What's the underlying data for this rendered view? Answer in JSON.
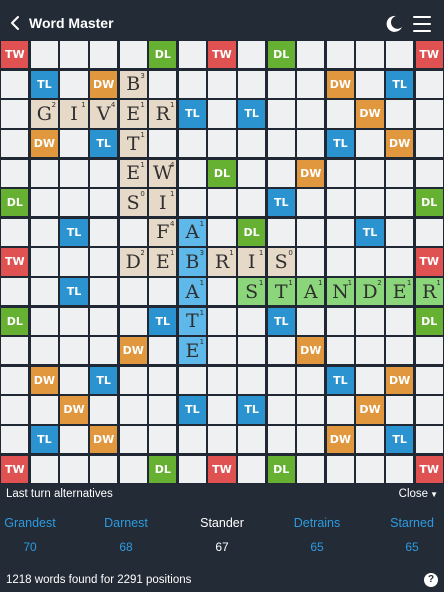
{
  "header": {
    "title": "Word Master",
    "back_icon": "chevron-left-icon",
    "theme_icon": "moon-icon",
    "menu_icon": "hamburger-icon"
  },
  "colors": {
    "TW": "#e05252",
    "DW": "#e0973e",
    "TL": "#2a93d0",
    "DL": "#66b132",
    "tile_placed": "#e6d9c8",
    "tile_blue": "#5fb8ea",
    "tile_green": "#8bd67a",
    "empty": "#eef0f1",
    "background": "#222b36",
    "accent": "#2d9be0"
  },
  "board": {
    "size": 15,
    "premium": [
      {
        "r": 0,
        "c": 0,
        "t": "TW"
      },
      {
        "r": 0,
        "c": 5,
        "t": "DL"
      },
      {
        "r": 0,
        "c": 7,
        "t": "TW"
      },
      {
        "r": 0,
        "c": 9,
        "t": "DL"
      },
      {
        "r": 0,
        "c": 14,
        "t": "TW"
      },
      {
        "r": 1,
        "c": 1,
        "t": "TL"
      },
      {
        "r": 1,
        "c": 3,
        "t": "DW"
      },
      {
        "r": 1,
        "c": 11,
        "t": "DW"
      },
      {
        "r": 1,
        "c": 13,
        "t": "TL"
      },
      {
        "r": 2,
        "c": 6,
        "t": "TL"
      },
      {
        "r": 2,
        "c": 8,
        "t": "TL"
      },
      {
        "r": 2,
        "c": 12,
        "t": "DW"
      },
      {
        "r": 3,
        "c": 1,
        "t": "DW"
      },
      {
        "r": 3,
        "c": 3,
        "t": "TL"
      },
      {
        "r": 3,
        "c": 11,
        "t": "TL"
      },
      {
        "r": 3,
        "c": 13,
        "t": "DW"
      },
      {
        "r": 4,
        "c": 7,
        "t": "DL"
      },
      {
        "r": 4,
        "c": 10,
        "t": "DW"
      },
      {
        "r": 5,
        "c": 0,
        "t": "DL"
      },
      {
        "r": 5,
        "c": 9,
        "t": "TL"
      },
      {
        "r": 5,
        "c": 14,
        "t": "DL"
      },
      {
        "r": 6,
        "c": 2,
        "t": "TL"
      },
      {
        "r": 6,
        "c": 8,
        "t": "DL"
      },
      {
        "r": 6,
        "c": 12,
        "t": "TL"
      },
      {
        "r": 7,
        "c": 0,
        "t": "TW"
      },
      {
        "r": 7,
        "c": 14,
        "t": "TW"
      },
      {
        "r": 8,
        "c": 2,
        "t": "TL"
      },
      {
        "r": 9,
        "c": 0,
        "t": "DL"
      },
      {
        "r": 9,
        "c": 5,
        "t": "TL"
      },
      {
        "r": 9,
        "c": 9,
        "t": "TL"
      },
      {
        "r": 9,
        "c": 14,
        "t": "DL"
      },
      {
        "r": 10,
        "c": 4,
        "t": "DW"
      },
      {
        "r": 10,
        "c": 10,
        "t": "DW"
      },
      {
        "r": 11,
        "c": 1,
        "t": "DW"
      },
      {
        "r": 11,
        "c": 3,
        "t": "TL"
      },
      {
        "r": 11,
        "c": 11,
        "t": "TL"
      },
      {
        "r": 11,
        "c": 13,
        "t": "DW"
      },
      {
        "r": 12,
        "c": 2,
        "t": "DW"
      },
      {
        "r": 12,
        "c": 6,
        "t": "TL"
      },
      {
        "r": 12,
        "c": 8,
        "t": "TL"
      },
      {
        "r": 12,
        "c": 12,
        "t": "DW"
      },
      {
        "r": 13,
        "c": 1,
        "t": "TL"
      },
      {
        "r": 13,
        "c": 3,
        "t": "DW"
      },
      {
        "r": 13,
        "c": 11,
        "t": "DW"
      },
      {
        "r": 13,
        "c": 13,
        "t": "TL"
      },
      {
        "r": 14,
        "c": 0,
        "t": "TW"
      },
      {
        "r": 14,
        "c": 5,
        "t": "DL"
      },
      {
        "r": 14,
        "c": 7,
        "t": "TW"
      },
      {
        "r": 14,
        "c": 9,
        "t": "DL"
      },
      {
        "r": 14,
        "c": 14,
        "t": "TW"
      }
    ],
    "tiles": [
      {
        "r": 1,
        "c": 4,
        "l": "B",
        "p": "3",
        "k": "old"
      },
      {
        "r": 2,
        "c": 1,
        "l": "G",
        "p": "2",
        "k": "old"
      },
      {
        "r": 2,
        "c": 2,
        "l": "I",
        "p": "1",
        "k": "old"
      },
      {
        "r": 2,
        "c": 3,
        "l": "V",
        "p": "4",
        "k": "old"
      },
      {
        "r": 2,
        "c": 4,
        "l": "E",
        "p": "1",
        "k": "old"
      },
      {
        "r": 2,
        "c": 5,
        "l": "R",
        "p": "1",
        "k": "old"
      },
      {
        "r": 3,
        "c": 4,
        "l": "T",
        "p": "1",
        "k": "old"
      },
      {
        "r": 4,
        "c": 4,
        "l": "E",
        "p": "1",
        "k": "old"
      },
      {
        "r": 4,
        "c": 5,
        "l": "W",
        "p": "4",
        "k": "old"
      },
      {
        "r": 5,
        "c": 4,
        "l": "S",
        "p": "0",
        "k": "old"
      },
      {
        "r": 5,
        "c": 5,
        "l": "I",
        "p": "1",
        "k": "old"
      },
      {
        "r": 6,
        "c": 5,
        "l": "F",
        "p": "4",
        "k": "old"
      },
      {
        "r": 6,
        "c": 6,
        "l": "A",
        "p": "1",
        "k": "blue"
      },
      {
        "r": 7,
        "c": 4,
        "l": "D",
        "p": "2",
        "k": "old"
      },
      {
        "r": 7,
        "c": 5,
        "l": "E",
        "p": "1",
        "k": "old"
      },
      {
        "r": 7,
        "c": 6,
        "l": "B",
        "p": "3",
        "k": "blue"
      },
      {
        "r": 7,
        "c": 7,
        "l": "R",
        "p": "1",
        "k": "old"
      },
      {
        "r": 7,
        "c": 8,
        "l": "I",
        "p": "1",
        "k": "old"
      },
      {
        "r": 7,
        "c": 9,
        "l": "S",
        "p": "0",
        "k": "old"
      },
      {
        "r": 8,
        "c": 6,
        "l": "A",
        "p": "1",
        "k": "blue"
      },
      {
        "r": 8,
        "c": 8,
        "l": "S",
        "p": "1",
        "k": "green"
      },
      {
        "r": 8,
        "c": 9,
        "l": "T",
        "p": "1",
        "k": "green"
      },
      {
        "r": 8,
        "c": 10,
        "l": "A",
        "p": "1",
        "k": "green"
      },
      {
        "r": 8,
        "c": 11,
        "l": "N",
        "p": "1",
        "k": "green"
      },
      {
        "r": 8,
        "c": 12,
        "l": "D",
        "p": "2",
        "k": "green"
      },
      {
        "r": 8,
        "c": 13,
        "l": "E",
        "p": "1",
        "k": "green"
      },
      {
        "r": 8,
        "c": 14,
        "l": "R",
        "p": "1",
        "k": "green"
      },
      {
        "r": 9,
        "c": 6,
        "l": "T",
        "p": "1",
        "k": "blue"
      },
      {
        "r": 10,
        "c": 6,
        "l": "E",
        "p": "1",
        "k": "blue"
      }
    ]
  },
  "alternatives": {
    "label": "Last turn alternatives",
    "close_label": "Close",
    "items": [
      {
        "word": "Grandest",
        "score": "70",
        "current": false
      },
      {
        "word": "Darnest",
        "score": "68",
        "current": false
      },
      {
        "word": "Stander",
        "score": "67",
        "current": true
      },
      {
        "word": "Detrains",
        "score": "65",
        "current": false
      },
      {
        "word": "Starned",
        "score": "65",
        "current": false
      }
    ]
  },
  "footer": {
    "summary": "1218 words found for 2291 positions",
    "help_icon": "help-icon",
    "help_glyph": "?"
  }
}
